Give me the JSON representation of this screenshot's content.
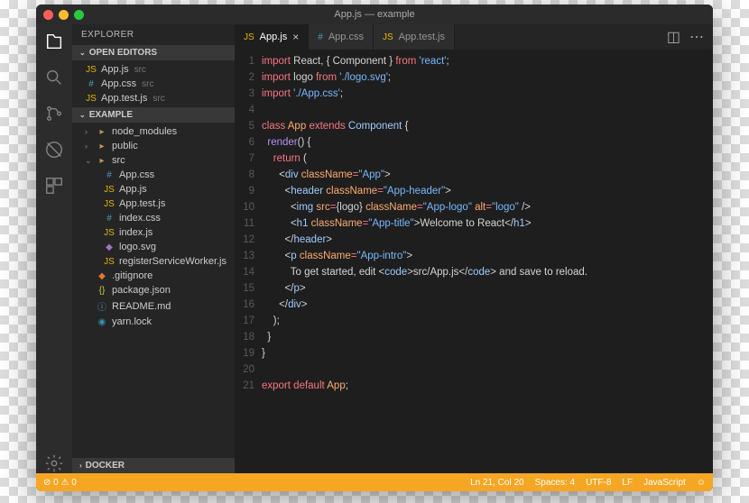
{
  "window": {
    "title": "App.js — example"
  },
  "activitybar": [
    "explorer",
    "search",
    "git",
    "debug",
    "extensions"
  ],
  "sidebar": {
    "title": "EXPLORER",
    "sections": {
      "openEditors": {
        "label": "OPEN EDITORS",
        "items": [
          {
            "icon": "js",
            "name": "App.js",
            "meta": "src"
          },
          {
            "icon": "css",
            "name": "App.css",
            "meta": "src"
          },
          {
            "icon": "js",
            "name": "App.test.js",
            "meta": "src"
          }
        ]
      },
      "workspace": {
        "label": "EXAMPLE",
        "tree": [
          {
            "icon": "folder",
            "name": "node_modules",
            "indent": 0,
            "chev": "›"
          },
          {
            "icon": "folder",
            "name": "public",
            "indent": 0,
            "chev": "›"
          },
          {
            "icon": "folder",
            "name": "src",
            "indent": 0,
            "chev": "⌄"
          },
          {
            "icon": "css",
            "name": "App.css",
            "indent": 1
          },
          {
            "icon": "js",
            "name": "App.js",
            "indent": 1
          },
          {
            "icon": "js",
            "name": "App.test.js",
            "indent": 1
          },
          {
            "icon": "css",
            "name": "index.css",
            "indent": 1
          },
          {
            "icon": "js",
            "name": "index.js",
            "indent": 1
          },
          {
            "icon": "svg",
            "name": "logo.svg",
            "indent": 1
          },
          {
            "icon": "js",
            "name": "registerServiceWorker.js",
            "indent": 1
          },
          {
            "icon": "git",
            "name": ".gitignore",
            "indent": 0
          },
          {
            "icon": "json",
            "name": "package.json",
            "indent": 0
          },
          {
            "icon": "md",
            "name": "README.md",
            "indent": 0
          },
          {
            "icon": "yarn",
            "name": "yarn.lock",
            "indent": 0
          }
        ]
      },
      "docker": {
        "label": "DOCKER"
      }
    }
  },
  "tabs": [
    {
      "icon": "js",
      "label": "App.js",
      "active": true,
      "close": true
    },
    {
      "icon": "css",
      "label": "App.css",
      "active": false
    },
    {
      "icon": "js",
      "label": "App.test.js",
      "active": false
    }
  ],
  "code": {
    "lines": [
      [
        [
          "k-red",
          "import"
        ],
        [
          "k-white",
          " React, { Component } "
        ],
        [
          "k-red",
          "from"
        ],
        [
          "k-white",
          " "
        ],
        [
          "k-str",
          "'react'"
        ],
        [
          "k-white",
          ";"
        ]
      ],
      [
        [
          "k-red",
          "import"
        ],
        [
          "k-white",
          " logo "
        ],
        [
          "k-red",
          "from"
        ],
        [
          "k-white",
          " "
        ],
        [
          "k-str",
          "'./logo.svg'"
        ],
        [
          "k-white",
          ";"
        ]
      ],
      [
        [
          "k-red",
          "import"
        ],
        [
          "k-white",
          " "
        ],
        [
          "k-str",
          "'./App.css'"
        ],
        [
          "k-white",
          ";"
        ]
      ],
      [],
      [
        [
          "k-red",
          "class"
        ],
        [
          "k-white",
          " "
        ],
        [
          "k-orange",
          "App"
        ],
        [
          "k-white",
          " "
        ],
        [
          "k-red",
          "extends"
        ],
        [
          "k-white",
          " "
        ],
        [
          "k-green",
          "Component"
        ],
        [
          "k-white",
          " {"
        ]
      ],
      [
        [
          "k-white",
          "  "
        ],
        [
          "k-purple",
          "render"
        ],
        [
          "k-white",
          "() {"
        ]
      ],
      [
        [
          "k-white",
          "    "
        ],
        [
          "k-red",
          "return"
        ],
        [
          "k-white",
          " ("
        ]
      ],
      [
        [
          "k-white",
          "      <"
        ],
        [
          "k-green",
          "div"
        ],
        [
          "k-white",
          " "
        ],
        [
          "k-attr",
          "className"
        ],
        [
          "k-red",
          "="
        ],
        [
          "k-str",
          "\"App\""
        ],
        [
          "k-white",
          ">"
        ]
      ],
      [
        [
          "k-white",
          "        <"
        ],
        [
          "k-green",
          "header"
        ],
        [
          "k-white",
          " "
        ],
        [
          "k-attr",
          "className"
        ],
        [
          "k-red",
          "="
        ],
        [
          "k-str",
          "\"App-header\""
        ],
        [
          "k-white",
          ">"
        ]
      ],
      [
        [
          "k-white",
          "          <"
        ],
        [
          "k-green",
          "img"
        ],
        [
          "k-white",
          " "
        ],
        [
          "k-attr",
          "src"
        ],
        [
          "k-red",
          "="
        ],
        [
          "k-white",
          "{logo} "
        ],
        [
          "k-attr",
          "className"
        ],
        [
          "k-red",
          "="
        ],
        [
          "k-str",
          "\"App-logo\""
        ],
        [
          "k-white",
          " "
        ],
        [
          "k-attr",
          "alt"
        ],
        [
          "k-red",
          "="
        ],
        [
          "k-str",
          "\"logo\""
        ],
        [
          "k-white",
          " />"
        ]
      ],
      [
        [
          "k-white",
          "          <"
        ],
        [
          "k-green",
          "h1"
        ],
        [
          "k-white",
          " "
        ],
        [
          "k-attr",
          "className"
        ],
        [
          "k-red",
          "="
        ],
        [
          "k-str",
          "\"App-title\""
        ],
        [
          "k-white",
          ">Welcome to React</"
        ],
        [
          "k-green",
          "h1"
        ],
        [
          "k-white",
          ">"
        ]
      ],
      [
        [
          "k-white",
          "        </"
        ],
        [
          "k-green",
          "header"
        ],
        [
          "k-white",
          ">"
        ]
      ],
      [
        [
          "k-white",
          "        <"
        ],
        [
          "k-green",
          "p"
        ],
        [
          "k-white",
          " "
        ],
        [
          "k-attr",
          "className"
        ],
        [
          "k-red",
          "="
        ],
        [
          "k-str",
          "\"App-intro\""
        ],
        [
          "k-white",
          ">"
        ]
      ],
      [
        [
          "k-white",
          "          To get started, edit <"
        ],
        [
          "k-green",
          "code"
        ],
        [
          "k-white",
          ">src/App.js</"
        ],
        [
          "k-green",
          "code"
        ],
        [
          "k-white",
          "> and save to reload."
        ]
      ],
      [
        [
          "k-white",
          "        </"
        ],
        [
          "k-green",
          "p"
        ],
        [
          "k-white",
          ">"
        ]
      ],
      [
        [
          "k-white",
          "      </"
        ],
        [
          "k-green",
          "div"
        ],
        [
          "k-white",
          ">"
        ]
      ],
      [
        [
          "k-white",
          "    );"
        ]
      ],
      [
        [
          "k-white",
          "  }"
        ]
      ],
      [
        [
          "k-white",
          "}"
        ]
      ],
      [],
      [
        [
          "k-red",
          "export"
        ],
        [
          "k-white",
          " "
        ],
        [
          "k-red",
          "default"
        ],
        [
          "k-white",
          " "
        ],
        [
          "k-orange",
          "App"
        ],
        [
          "k-white",
          ";"
        ]
      ]
    ]
  },
  "statusbar": {
    "left": [
      "⊘ 0 ⚠ 0"
    ],
    "right": [
      "Ln 21, Col 20",
      "Spaces: 4",
      "UTF-8",
      "LF",
      "JavaScript",
      "☺"
    ]
  }
}
